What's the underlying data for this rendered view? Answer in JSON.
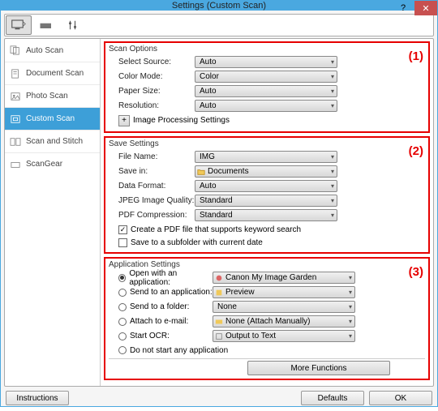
{
  "title": "Settings (Custom Scan)",
  "sidebar": {
    "items": [
      {
        "label": "Auto Scan"
      },
      {
        "label": "Document Scan"
      },
      {
        "label": "Photo Scan"
      },
      {
        "label": "Custom Scan"
      },
      {
        "label": "Scan and Stitch"
      },
      {
        "label": "ScanGear"
      }
    ]
  },
  "scan_options": {
    "legend": "Scan Options",
    "num": "(1)",
    "rows": {
      "source_label": "Select Source:",
      "source_value": "Auto",
      "colormode_label": "Color Mode:",
      "colormode_value": "Color",
      "papersize_label": "Paper Size:",
      "papersize_value": "Auto",
      "resolution_label": "Resolution:",
      "resolution_value": "Auto"
    },
    "expand_label": "Image Processing Settings"
  },
  "save_settings": {
    "legend": "Save Settings",
    "num": "(2)",
    "rows": {
      "filename_label": "File Name:",
      "filename_value": "IMG",
      "savein_label": "Save in:",
      "savein_value": "Documents",
      "format_label": "Data Format:",
      "format_value": "Auto",
      "jpeg_label": "JPEG Image Quality:",
      "jpeg_value": "Standard",
      "pdf_label": "PDF Compression:",
      "pdf_value": "Standard"
    },
    "check1_label": "Create a PDF file that supports keyword search",
    "check2_label": "Save to a subfolder with current date"
  },
  "app_settings": {
    "legend": "Application Settings",
    "num": "(3)",
    "rows": {
      "open_label": "Open with an application:",
      "open_value": "Canon My Image Garden",
      "sendapp_label": "Send to an application:",
      "sendapp_value": "Preview",
      "sendfolder_label": "Send to a folder:",
      "sendfolder_value": "None",
      "email_label": "Attach to e-mail:",
      "email_value": "None (Attach Manually)",
      "ocr_label": "Start OCR:",
      "ocr_value": "Output to Text",
      "none_label": "Do not start any application"
    },
    "more_fn": "More Functions"
  },
  "footer": {
    "instructions": "Instructions",
    "defaults": "Defaults",
    "ok": "OK"
  }
}
